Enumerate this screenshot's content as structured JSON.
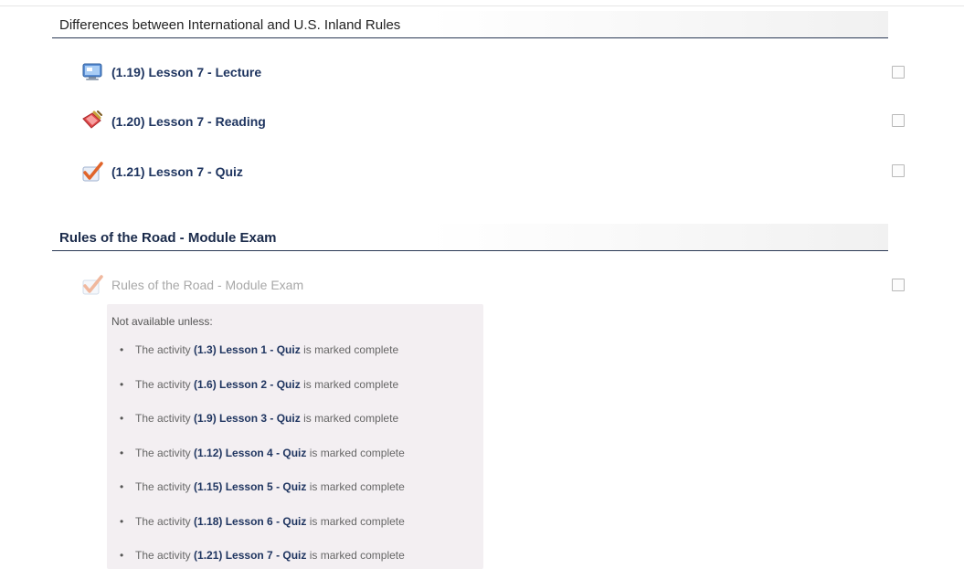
{
  "sections": [
    {
      "title": "Differences between International and U.S. Inland Rules",
      "activities": [
        {
          "label": "(1.19) Lesson 7 - Lecture",
          "icon": "lecture-icon"
        },
        {
          "label": "(1.20) Lesson 7 - Reading",
          "icon": "reading-icon"
        },
        {
          "label": "(1.21) Lesson 7 - Quiz",
          "icon": "quiz-icon"
        }
      ]
    },
    {
      "title": "Rules of the Road - Module Exam",
      "activities": [
        {
          "label": "Rules of the Road - Module Exam",
          "icon": "quiz-icon",
          "available": false
        }
      ]
    }
  ],
  "restriction": {
    "heading": "Not available unless:",
    "items": [
      {
        "prefix": "The activity",
        "activity": "(1.3) Lesson 1 - Quiz",
        "suffix": "is marked complete"
      },
      {
        "prefix": "The activity",
        "activity": "(1.6) Lesson 2 - Quiz",
        "suffix": "is marked complete"
      },
      {
        "prefix": "The activity",
        "activity": "(1.9) Lesson 3 - Quiz",
        "suffix": "is marked complete"
      },
      {
        "prefix": "The activity",
        "activity": "(1.12) Lesson 4 - Quiz",
        "suffix": "is marked complete"
      },
      {
        "prefix": "The activity",
        "activity": "(1.15) Lesson 5 - Quiz",
        "suffix": "is marked complete"
      },
      {
        "prefix": "The activity",
        "activity": "(1.18) Lesson 6 - Quiz",
        "suffix": "is marked complete"
      },
      {
        "prefix": "The activity",
        "activity": "(1.21) Lesson 7 - Quiz",
        "suffix": "is marked complete"
      }
    ]
  },
  "colors": {
    "link": "#1f3560",
    "header_rule": "#2b3a55",
    "restriction_bg": "#f3eff2",
    "disabled_text": "#a8a8a8"
  }
}
